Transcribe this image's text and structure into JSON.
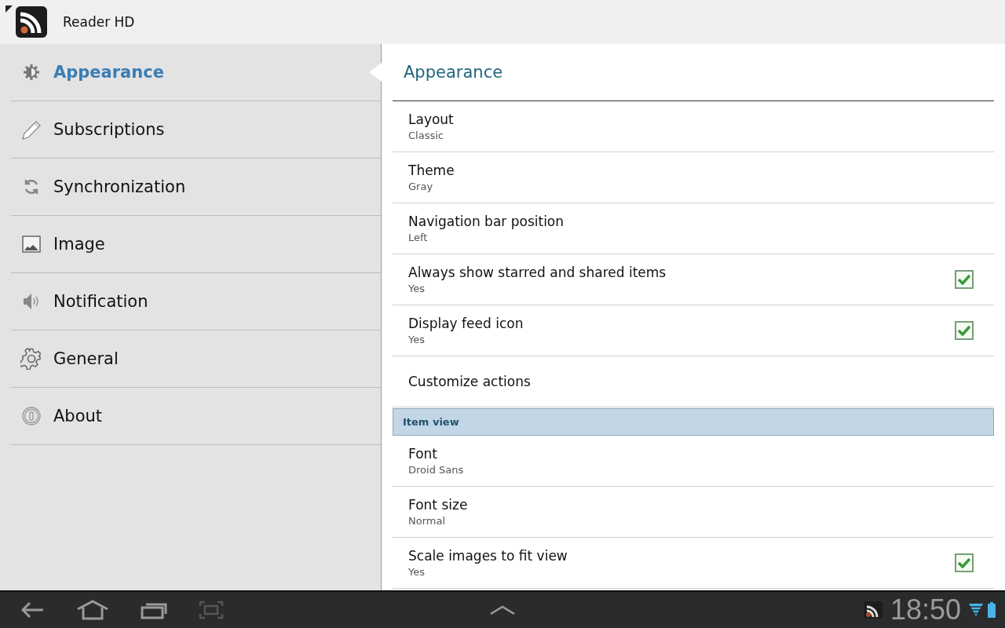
{
  "app": {
    "title": "Reader HD"
  },
  "sidebar": {
    "items": [
      {
        "label": "Appearance",
        "selected": true
      },
      {
        "label": "Subscriptions",
        "selected": false
      },
      {
        "label": "Synchronization",
        "selected": false
      },
      {
        "label": "Image",
        "selected": false
      },
      {
        "label": "Notification",
        "selected": false
      },
      {
        "label": "General",
        "selected": false
      },
      {
        "label": "About",
        "selected": false
      }
    ]
  },
  "panel": {
    "title": "Appearance",
    "items": [
      {
        "kind": "pref",
        "title": "Layout",
        "summary": "Classic"
      },
      {
        "kind": "pref",
        "title": "Theme",
        "summary": "Gray"
      },
      {
        "kind": "pref",
        "title": "Navigation bar position",
        "summary": "Left"
      },
      {
        "kind": "check",
        "title": "Always show starred and shared items",
        "summary": "Yes",
        "checked": true
      },
      {
        "kind": "check",
        "title": "Display feed icon",
        "summary": "Yes",
        "checked": true
      },
      {
        "kind": "pref",
        "title": "Customize actions"
      },
      {
        "kind": "section",
        "title": "Item view"
      },
      {
        "kind": "pref",
        "title": "Font",
        "summary": "Droid Sans"
      },
      {
        "kind": "pref",
        "title": "Font size",
        "summary": "Normal"
      },
      {
        "kind": "check",
        "title": "Scale images to fit view",
        "summary": "Yes",
        "checked": true
      }
    ]
  },
  "status_bar": {
    "time": "18:50"
  }
}
